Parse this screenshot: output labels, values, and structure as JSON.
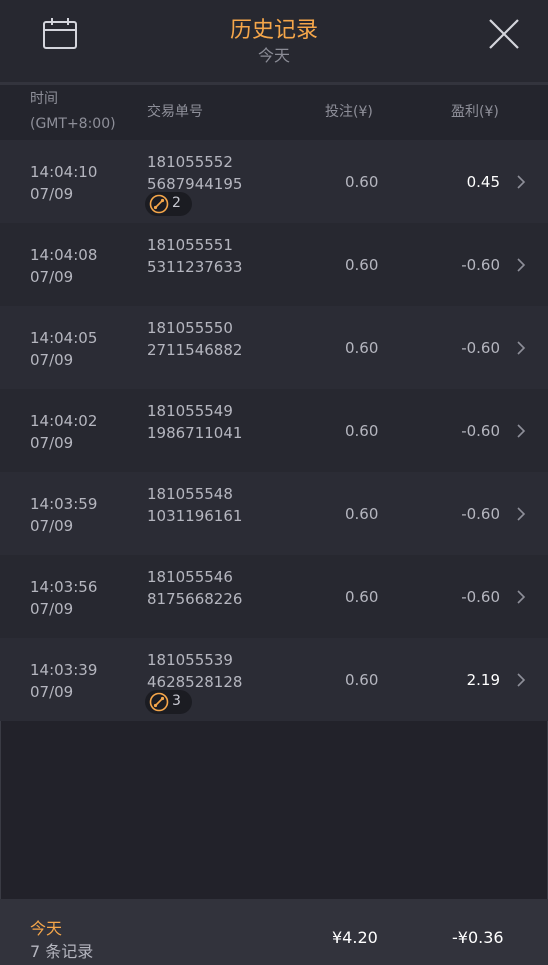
{
  "header": {
    "title": "历史记录",
    "subtitle": "今天"
  },
  "columns": {
    "time_line1": "时间",
    "time_line2": "(GMT+8:00)",
    "order": "交易单号",
    "stake": "投注(¥)",
    "profit": "盈利(¥)"
  },
  "colors": {
    "accent": "#f5a64a",
    "text": "#b5b6bf",
    "positive": "#ffffff"
  },
  "rows": [
    {
      "time": "14:04:10",
      "date": "07/09",
      "order1": "181055552",
      "order2": "5687944195",
      "stake": "0.60",
      "profit": "0.45",
      "positive": true,
      "badge": "2"
    },
    {
      "time": "14:04:08",
      "date": "07/09",
      "order1": "181055551",
      "order2": "5311237633",
      "stake": "0.60",
      "profit": "-0.60",
      "positive": false,
      "badge": null
    },
    {
      "time": "14:04:05",
      "date": "07/09",
      "order1": "181055550",
      "order2": "2711546882",
      "stake": "0.60",
      "profit": "-0.60",
      "positive": false,
      "badge": null
    },
    {
      "time": "14:04:02",
      "date": "07/09",
      "order1": "181055549",
      "order2": "1986711041",
      "stake": "0.60",
      "profit": "-0.60",
      "positive": false,
      "badge": null
    },
    {
      "time": "14:03:59",
      "date": "07/09",
      "order1": "181055548",
      "order2": "1031196161",
      "stake": "0.60",
      "profit": "-0.60",
      "positive": false,
      "badge": null
    },
    {
      "time": "14:03:56",
      "date": "07/09",
      "order1": "181055546",
      "order2": "8175668226",
      "stake": "0.60",
      "profit": "-0.60",
      "positive": false,
      "badge": null
    },
    {
      "time": "14:03:39",
      "date": "07/09",
      "order1": "181055539",
      "order2": "4628528128",
      "stake": "0.60",
      "profit": "2.19",
      "positive": true,
      "badge": "3"
    }
  ],
  "footer": {
    "today": "今天",
    "count": "7 条记录",
    "total_stake": "¥4.20",
    "total_profit": "-¥0.36"
  },
  "icons": {
    "calendar": "calendar-icon",
    "close": "close-icon",
    "chevron": "chevron-right-icon",
    "badge": "parlay-icon"
  }
}
